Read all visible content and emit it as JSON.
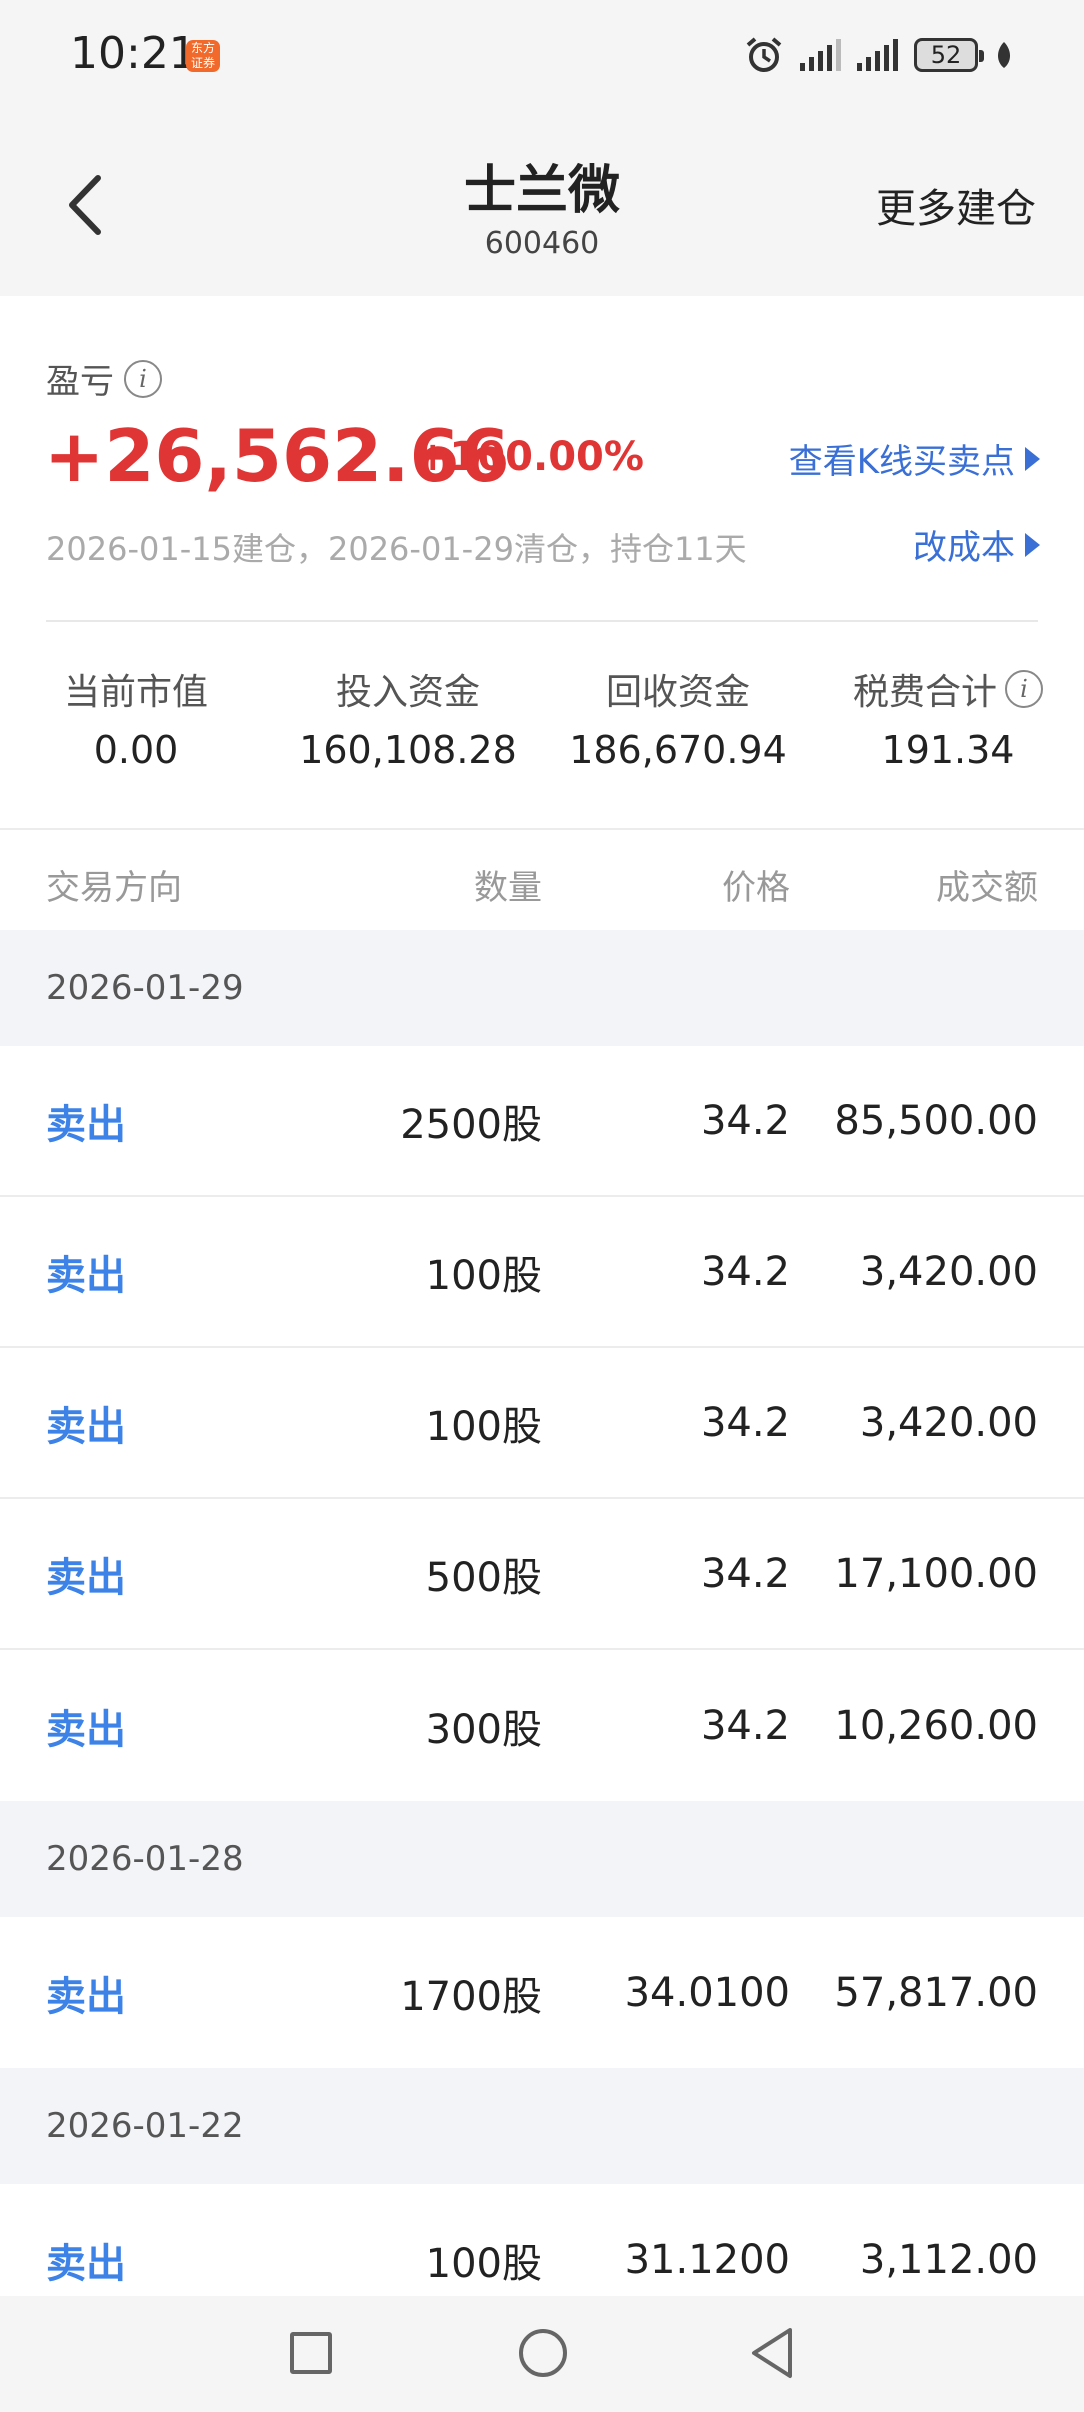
{
  "status_bar": {
    "time": "10:21",
    "app_badge": "东方\n证券",
    "battery": "52"
  },
  "header": {
    "title": "士兰微",
    "code": "600460",
    "more_label": "更多建仓"
  },
  "summary": {
    "pnl_label": "盈亏",
    "pnl_value": "+26,562.66",
    "pnl_percent": "+100.00%",
    "kline_link": "查看K线买卖点",
    "position_info": "2026-01-15建仓，2026-01-29清仓，持仓11天",
    "cost_link": "改成本",
    "stats": [
      {
        "label": "当前市值",
        "value": "0.00"
      },
      {
        "label": "投入资金",
        "value": "160,108.28"
      },
      {
        "label": "回收资金",
        "value": "186,670.94"
      },
      {
        "label": "税费合计",
        "value": "191.34"
      }
    ]
  },
  "table": {
    "headers": {
      "direction": "交易方向",
      "quantity": "数量",
      "price": "价格",
      "amount": "成交额"
    },
    "groups": [
      {
        "date": "2026-01-29",
        "rows": [
          {
            "direction": "卖出",
            "quantity": "2500股",
            "price": "34.2",
            "amount": "85,500.00"
          },
          {
            "direction": "卖出",
            "quantity": "100股",
            "price": "34.2",
            "amount": "3,420.00"
          },
          {
            "direction": "卖出",
            "quantity": "100股",
            "price": "34.2",
            "amount": "3,420.00"
          },
          {
            "direction": "卖出",
            "quantity": "500股",
            "price": "34.2",
            "amount": "17,100.00"
          },
          {
            "direction": "卖出",
            "quantity": "300股",
            "price": "34.2",
            "amount": "10,260.00"
          }
        ]
      },
      {
        "date": "2026-01-28",
        "rows": [
          {
            "direction": "卖出",
            "quantity": "1700股",
            "price": "34.0100",
            "amount": "57,817.00"
          }
        ]
      },
      {
        "date": "2026-01-22",
        "rows": [
          {
            "direction": "卖出",
            "quantity": "100股",
            "price": "31.1200",
            "amount": "3,112.00"
          }
        ]
      }
    ]
  },
  "colors": {
    "profit_red": "#e03535",
    "link_blue": "#3a6fd6",
    "sell_blue": "#3d82e6",
    "date_row_bg": "#f3f4f8"
  }
}
